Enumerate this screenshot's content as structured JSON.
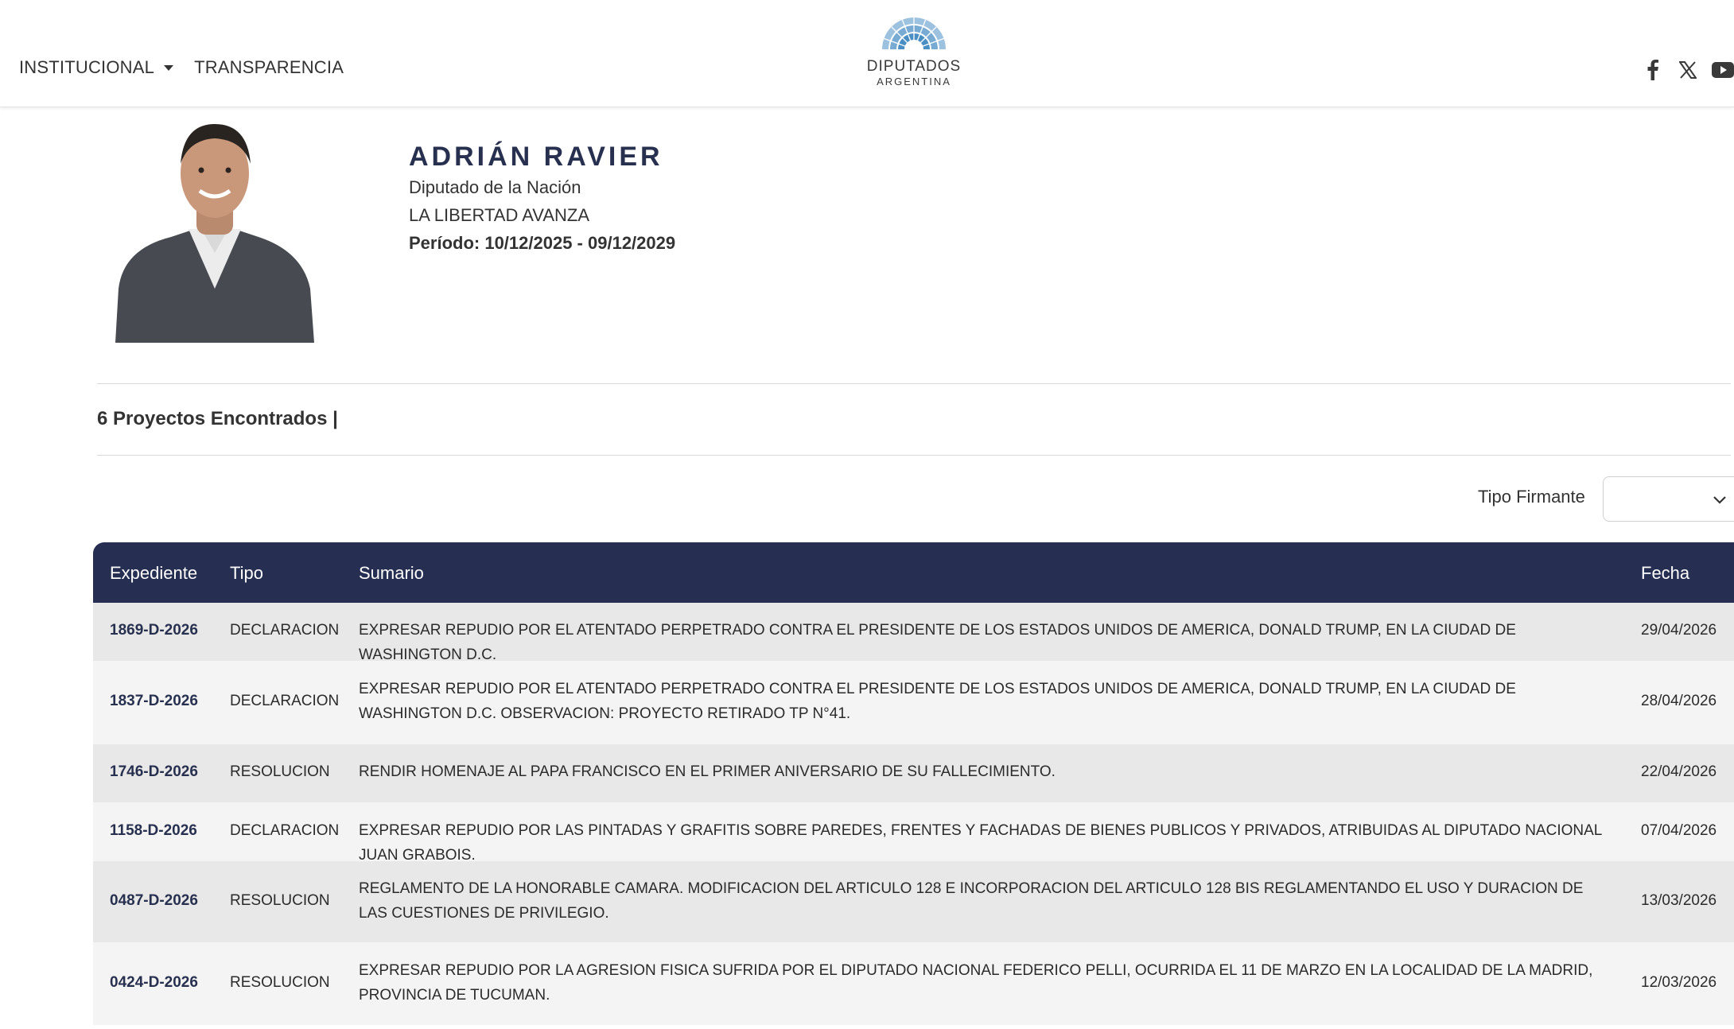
{
  "header": {
    "nav": [
      {
        "label": "INSTITUCIONAL",
        "has_dropdown": true
      },
      {
        "label": "TRANSPARENCIA",
        "has_dropdown": false
      }
    ],
    "logo": {
      "line1": "DIPUTADOS",
      "line2": "ARGENTINA"
    },
    "social": [
      "facebook-icon",
      "x-icon",
      "youtube-icon"
    ]
  },
  "profile": {
    "name": "ADRIÁN RAVIER",
    "role": "Diputado de la Nación",
    "party": "LA LIBERTAD AVANZA",
    "period": "Período: 10/12/2025 - 09/12/2029"
  },
  "results": {
    "count_label": "6 Proyectos Encontrados |"
  },
  "filter": {
    "label": "Tipo Firmante",
    "value": ""
  },
  "table": {
    "headers": {
      "expediente": "Expediente",
      "tipo": "Tipo",
      "sumario": "Sumario",
      "fecha": "Fecha"
    },
    "rows": [
      {
        "expediente": "1869-D-2026",
        "tipo": "DECLARACION",
        "sumario": "EXPRESAR REPUDIO POR EL ATENTADO PERPETRADO CONTRA EL PRESIDENTE DE LOS ESTADOS UNIDOS DE AMERICA, DONALD TRUMP, EN LA CIUDAD DE WASHINGTON D.C.",
        "fecha": "29/04/2026"
      },
      {
        "expediente": "1837-D-2026",
        "tipo": "DECLARACION",
        "sumario": "EXPRESAR REPUDIO POR EL ATENTADO PERPETRADO CONTRA EL PRESIDENTE DE LOS ESTADOS UNIDOS DE AMERICA, DONALD TRUMP, EN LA CIUDAD DE WASHINGTON D.C. OBSERVACION: PROYECTO RETIRADO TP N°41.",
        "fecha": "28/04/2026"
      },
      {
        "expediente": "1746-D-2026",
        "tipo": "RESOLUCION",
        "sumario": "RENDIR HOMENAJE AL PAPA FRANCISCO EN EL PRIMER ANIVERSARIO DE SU FALLECIMIENTO.",
        "fecha": "22/04/2026"
      },
      {
        "expediente": "1158-D-2026",
        "tipo": "DECLARACION",
        "sumario": "EXPRESAR REPUDIO POR LAS PINTADAS Y GRAFITIS SOBRE PAREDES, FRENTES Y FACHADAS DE BIENES PUBLICOS Y PRIVADOS, ATRIBUIDAS AL DIPUTADO NACIONAL JUAN GRABOIS.",
        "fecha": "07/04/2026"
      },
      {
        "expediente": "0487-D-2026",
        "tipo": "RESOLUCION",
        "sumario": "REGLAMENTO DE LA HONORABLE CAMARA. MODIFICACION DEL ARTICULO 128 E INCORPORACION DEL ARTICULO 128 BIS REGLAMENTANDO EL USO Y DURACION DE LAS CUESTIONES DE PRIVILEGIO.",
        "fecha": "13/03/2026"
      },
      {
        "expediente": "0424-D-2026",
        "tipo": "RESOLUCION",
        "sumario": "EXPRESAR REPUDIO POR LA AGRESION FISICA SUFRIDA POR EL DIPUTADO NACIONAL FEDERICO PELLI, OCURRIDA EL 11 DE MARZO EN LA LOCALIDAD DE LA MADRID, PROVINCIA DE TUCUMAN.",
        "fecha": "12/03/2026"
      }
    ]
  },
  "colors": {
    "navy": "#262e52",
    "row_odd": "#e8e8e8",
    "row_even": "#f4f4f4",
    "logo_blue": "#4a8fc4"
  }
}
